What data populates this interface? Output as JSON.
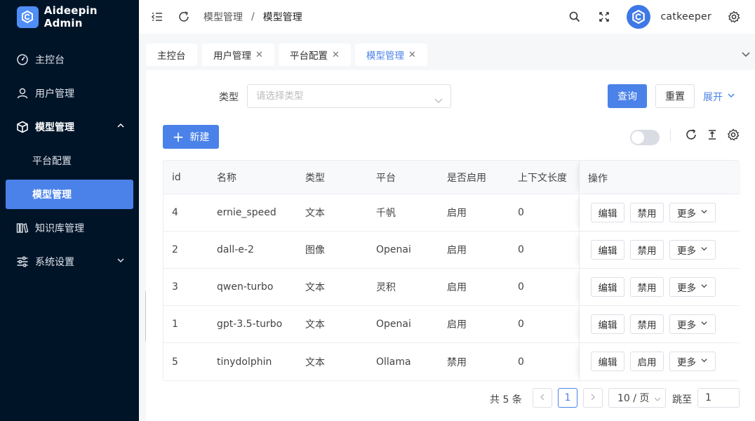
{
  "app": {
    "title": "Aideepin Admin"
  },
  "sidebar": {
    "items": [
      {
        "label": "主控台",
        "icon": "dashboard-icon"
      },
      {
        "label": "用户管理",
        "icon": "user-icon"
      },
      {
        "label": "模型管理",
        "icon": "cube-icon",
        "expanded": true
      },
      {
        "label": "平台配置",
        "sub": true
      },
      {
        "label": "模型管理",
        "sub": true,
        "active": true
      },
      {
        "label": "知识库管理",
        "icon": "library-icon"
      },
      {
        "label": "系统设置",
        "icon": "sliders-icon"
      }
    ]
  },
  "header": {
    "breadcrumb": [
      "模型管理",
      "模型管理"
    ],
    "separator": "/",
    "username": "catkeeper"
  },
  "tabs": [
    {
      "label": "主控台",
      "closable": false
    },
    {
      "label": "用户管理",
      "closable": true
    },
    {
      "label": "平台配置",
      "closable": true
    },
    {
      "label": "模型管理",
      "closable": true,
      "active": true
    }
  ],
  "filter": {
    "type_label": "类型",
    "type_placeholder": "请选择类型",
    "query_label": "查询",
    "reset_label": "重置",
    "expand_label": "展开"
  },
  "toolbar": {
    "new_label": "新建"
  },
  "table": {
    "columns": [
      "id",
      "名称",
      "类型",
      "平台",
      "是否启用",
      "上下文长度",
      "操作"
    ],
    "rows": [
      {
        "id": "4",
        "name": "ernie_speed",
        "type": "文本",
        "platform": "千帆",
        "enabled": "启用",
        "context": "0",
        "toggle_action": "禁用"
      },
      {
        "id": "2",
        "name": "dall-e-2",
        "type": "图像",
        "platform": "Openai",
        "enabled": "启用",
        "context": "0",
        "toggle_action": "禁用"
      },
      {
        "id": "3",
        "name": "qwen-turbo",
        "type": "文本",
        "platform": "灵积",
        "enabled": "启用",
        "context": "0",
        "toggle_action": "禁用"
      },
      {
        "id": "1",
        "name": "gpt-3.5-turbo",
        "type": "文本",
        "platform": "Openai",
        "enabled": "启用",
        "context": "0",
        "toggle_action": "禁用"
      },
      {
        "id": "5",
        "name": "tinydolphin",
        "type": "文本",
        "platform": "Ollama",
        "enabled": "禁用",
        "context": "0",
        "toggle_action": "启用"
      }
    ],
    "edit_label": "编辑",
    "more_label": "更多"
  },
  "pagination": {
    "total_text": "共 5 条",
    "current_page": "1",
    "page_size": "10 / 页",
    "goto_label": "跳至",
    "goto_value": "1"
  },
  "colors": {
    "sidebar_bg": "#001428",
    "primary": "#4a82e9"
  }
}
